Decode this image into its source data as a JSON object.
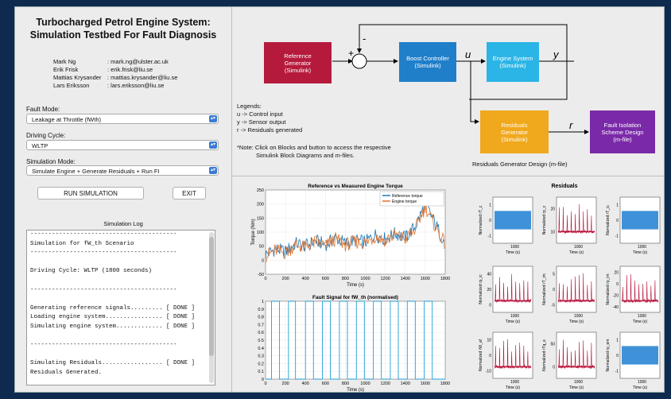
{
  "title_line1": "Turbocharged Petrol Engine System:",
  "title_line2": "Simulation Testbed For Fault Diagnosis",
  "authors": [
    {
      "name": "Mark Ng",
      "email": ": mark.ng@ulster.ac.uk"
    },
    {
      "name": "Erik Frisk",
      "email": ": erik.frisk@liu.se"
    },
    {
      "name": "Mattias Krysander",
      "email": ": mattias.krysander@liu.se"
    },
    {
      "name": "Lars Eriksson",
      "email": ": lars.eriksson@liu.se"
    }
  ],
  "fault_mode": {
    "label": "Fault Mode:",
    "value": "Leakage at Throttle (fWth)"
  },
  "driving_cycle": {
    "label": "Driving Cycle:",
    "value": "WLTP"
  },
  "sim_mode": {
    "label": "Simulation Mode:",
    "value": "Simulate Engine + Generate Residuals + Run FI"
  },
  "buttons": {
    "run": "RUN SIMULATION",
    "exit": "EXIT"
  },
  "log": {
    "title": "Simulation Log",
    "lines": [
      "-----------------------------------------",
      "Simulation for fW_th Scenario",
      "-----------------------------------------",
      "",
      "Driving Cycle: WLTP (1800 seconds)",
      "",
      "-----------------------------------------",
      "",
      "Generating reference signals......... [ DONE ]",
      "Loading engine system................ [ DONE ]",
      "Simulating engine system............. [ DONE ]",
      "",
      "-----------------------------------------",
      "",
      "Simulating Residuals................. [ DONE ]",
      "Residuals Generated.",
      "",
      "Plotting residual signals............ [ DONE ]",
      "",
      "-----------------------------------------"
    ]
  },
  "diagram": {
    "blocks": {
      "ref_gen": "Reference\nGenerator\n(Simulink)",
      "boost": "Boost Controller\n(Simulink)",
      "engine": "Engine System\n(Simulink)",
      "residuals": "Residuals\nGenerator\n(Simulink)",
      "fault_iso": "Fault Isolation\nScheme Design\n(m-file)"
    },
    "labels": {
      "plus": "+",
      "minus": "-",
      "u": "u",
      "y": "y",
      "r": "r"
    },
    "legend": [
      "Legends:",
      "u -> Control input",
      "y -> Sensor output",
      "r -> Residuals generated"
    ],
    "note": [
      "*Note: Click on Blocks and button to access the respective",
      "Simulink Block Diagrams and m-files."
    ],
    "residual_caption": "Residuals Generator Design (m-file)",
    "colors": {
      "ref_gen": "#b51a3c",
      "boost": "#1f7fc9",
      "engine": "#2ab5e6",
      "residuals": "#f0a81c",
      "fault_iso": "#7a2aa8"
    }
  },
  "chart_data": [
    {
      "type": "line",
      "title": "Reference vs Measured Engine Torque",
      "xlabel": "Time (s)",
      "ylabel": "Torque (Nm)",
      "xlim": [
        0,
        1800
      ],
      "ylim": [
        -50,
        250
      ],
      "xticks": [
        0,
        200,
        400,
        600,
        800,
        1000,
        1200,
        1400,
        1600,
        1800
      ],
      "yticks": [
        -50,
        0,
        50,
        100,
        150,
        200,
        250
      ],
      "series": [
        {
          "name": "Reference torque",
          "color": "#1f77b4",
          "x": [
            0,
            100,
            200,
            300,
            400,
            500,
            600,
            700,
            800,
            900,
            1000,
            1100,
            1200,
            1300,
            1400,
            1500,
            1600,
            1700,
            1800
          ],
          "y": [
            20,
            40,
            30,
            60,
            50,
            70,
            55,
            80,
            60,
            70,
            65,
            90,
            75,
            95,
            80,
            120,
            200,
            130,
            60
          ]
        },
        {
          "name": "Engine torque",
          "color": "#e0702a",
          "x": [
            0,
            100,
            200,
            300,
            400,
            500,
            600,
            700,
            800,
            900,
            1000,
            1100,
            1200,
            1300,
            1400,
            1500,
            1600,
            1700,
            1800
          ],
          "y": [
            15,
            35,
            25,
            55,
            45,
            65,
            50,
            75,
            55,
            65,
            60,
            85,
            70,
            90,
            75,
            110,
            190,
            120,
            55
          ]
        }
      ]
    },
    {
      "type": "line",
      "title": "Fault Signal for fW_th (normalised)",
      "xlabel": "Time (s)",
      "xlim": [
        0,
        1800
      ],
      "ylim": [
        0,
        1
      ],
      "xticks": [
        0,
        200,
        400,
        600,
        800,
        1000,
        1200,
        1400,
        1600,
        1800
      ],
      "yticks": [
        0,
        0.1,
        0.2,
        0.3,
        0.4,
        0.5,
        0.6,
        0.7,
        0.8,
        0.9,
        1
      ],
      "series": [
        {
          "color": "#1f9fd8",
          "pulses": [
            [
              60,
              140
            ],
            [
              230,
              300
            ],
            [
              400,
              480
            ],
            [
              570,
              650
            ],
            [
              740,
              820
            ],
            [
              910,
              990
            ],
            [
              1080,
              1160
            ],
            [
              1250,
              1330
            ],
            [
              1420,
              1500
            ],
            [
              1590,
              1670
            ]
          ]
        }
      ]
    },
    {
      "type": "line",
      "title": "Residuals",
      "xlabel": "Time (s)",
      "xticks": [
        1000
      ],
      "panels": [
        {
          "ylabel": "Normalized rT_c",
          "color": "#2a86d4",
          "yticks": [
            -1,
            0,
            1
          ]
        },
        {
          "ylabel": "Normalized rp_c",
          "color": "#b8143a",
          "yticks": [
            10,
            20
          ]
        },
        {
          "ylabel": "Normalized rT_ic",
          "color": "#2a86d4",
          "yticks": [
            -1,
            0,
            1
          ]
        },
        {
          "ylabel": "Normalized rp_ic",
          "color": "#b8143a",
          "yticks": [
            0,
            20,
            40
          ]
        },
        {
          "ylabel": "Normalized rT_im",
          "color": "#b8143a",
          "yticks": [
            -5,
            0,
            5
          ]
        },
        {
          "ylabel": "Normalized rp_im",
          "color": "#b8143a",
          "yticks": [
            -40,
            -20,
            0,
            20
          ]
        },
        {
          "ylabel": "Normalized rW_af",
          "color": "#b8143a",
          "yticks": [
            -10,
            0,
            10
          ]
        },
        {
          "ylabel": "Normalized rTq_e",
          "color": "#b8143a",
          "yticks": [
            0,
            50
          ]
        },
        {
          "ylabel": "Normalized rp_em",
          "color": "#2a86d4",
          "yticks": [
            -1,
            0,
            1
          ]
        }
      ]
    }
  ]
}
